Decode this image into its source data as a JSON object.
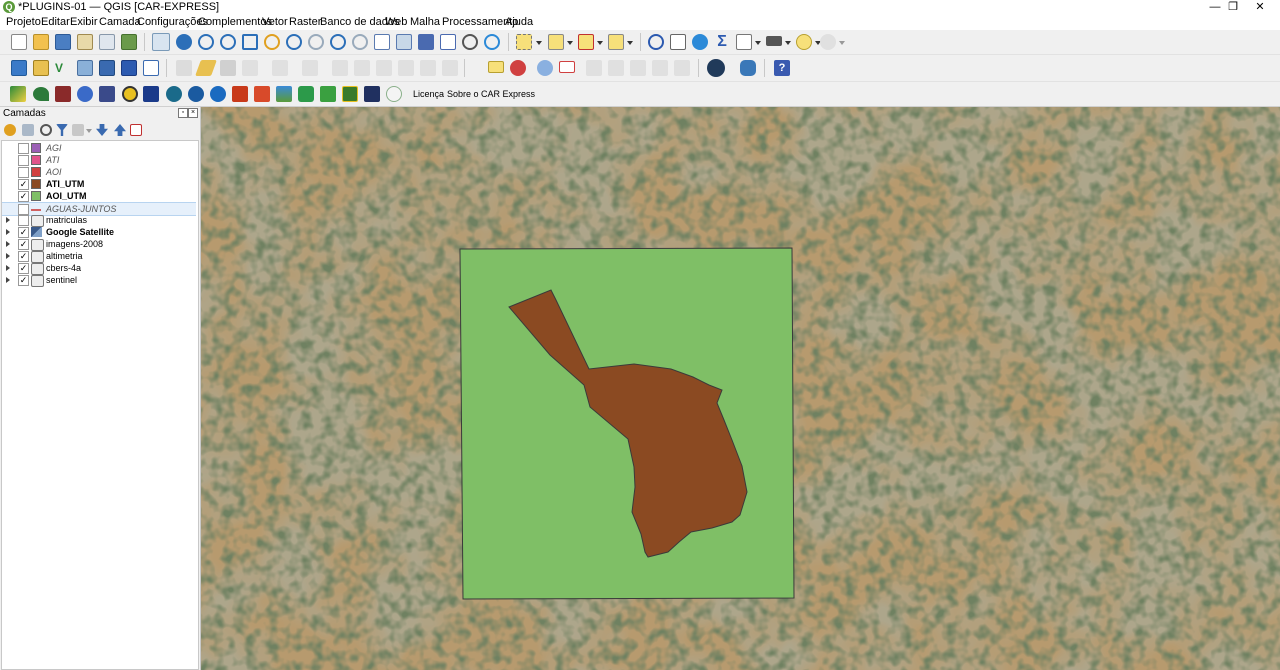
{
  "window": {
    "title": "*PLUGINS-01 — QGIS [CAR-EXPRESS]",
    "app_icon_letter": "Q",
    "minimize": "—",
    "maximize": "❐",
    "close": "✕"
  },
  "menu": [
    "Projeto",
    "Editar",
    "Exibir",
    "Camada",
    "Configurações",
    "Complementos",
    "Vetor",
    "Raster",
    "Banco de dados",
    "Web",
    "Malha",
    "Processamento",
    "Ajuda"
  ],
  "plugin_toolbar": {
    "licenca": "Licença",
    "sobre": "Sobre o CAR Express"
  },
  "panel": {
    "title": "Camadas",
    "float_btn": "▫",
    "close_btn": "×"
  },
  "layers": [
    {
      "name": "AGI",
      "checked": false,
      "italic": true,
      "bold": false,
      "color": "#9b5fb5",
      "kind": "polygon",
      "expandable": false
    },
    {
      "name": "ATI",
      "checked": false,
      "italic": true,
      "bold": false,
      "color": "#e0548a",
      "kind": "polygon",
      "expandable": false
    },
    {
      "name": "AOI",
      "checked": false,
      "italic": true,
      "bold": false,
      "color": "#d04040",
      "kind": "polygon",
      "expandable": false
    },
    {
      "name": "ATI_UTM",
      "checked": true,
      "italic": false,
      "bold": true,
      "color": "#8b4a22",
      "kind": "polygon",
      "expandable": false
    },
    {
      "name": "AOI_UTM",
      "checked": true,
      "italic": false,
      "bold": true,
      "color": "#7fbf66",
      "kind": "polygon",
      "expandable": false
    },
    {
      "name": "AGUAS-JUNTOS",
      "checked": false,
      "italic": true,
      "bold": false,
      "color": "#d06060",
      "kind": "line",
      "expandable": false,
      "selected": true
    },
    {
      "name": "matriculas",
      "checked": false,
      "italic": false,
      "bold": false,
      "color": "#777777",
      "kind": "group",
      "expandable": true
    },
    {
      "name": "Google Satellite",
      "checked": true,
      "italic": false,
      "bold": true,
      "color": "#3a5a8a",
      "kind": "raster",
      "expandable": true
    },
    {
      "name": "imagens-2008",
      "checked": true,
      "italic": false,
      "bold": false,
      "color": "#777777",
      "kind": "group",
      "expandable": true
    },
    {
      "name": "altimetria",
      "checked": true,
      "italic": false,
      "bold": false,
      "color": "#777777",
      "kind": "group",
      "expandable": true
    },
    {
      "name": "cbers-4a",
      "checked": true,
      "italic": false,
      "bold": false,
      "color": "#777777",
      "kind": "group",
      "expandable": true
    },
    {
      "name": "sentinel",
      "checked": true,
      "italic": false,
      "bold": false,
      "color": "#777777",
      "kind": "group",
      "expandable": true
    }
  ],
  "map": {
    "aoi_fill": "#7fbf66",
    "ati_fill": "#8b4a22",
    "outline": "#3a3a3a"
  }
}
